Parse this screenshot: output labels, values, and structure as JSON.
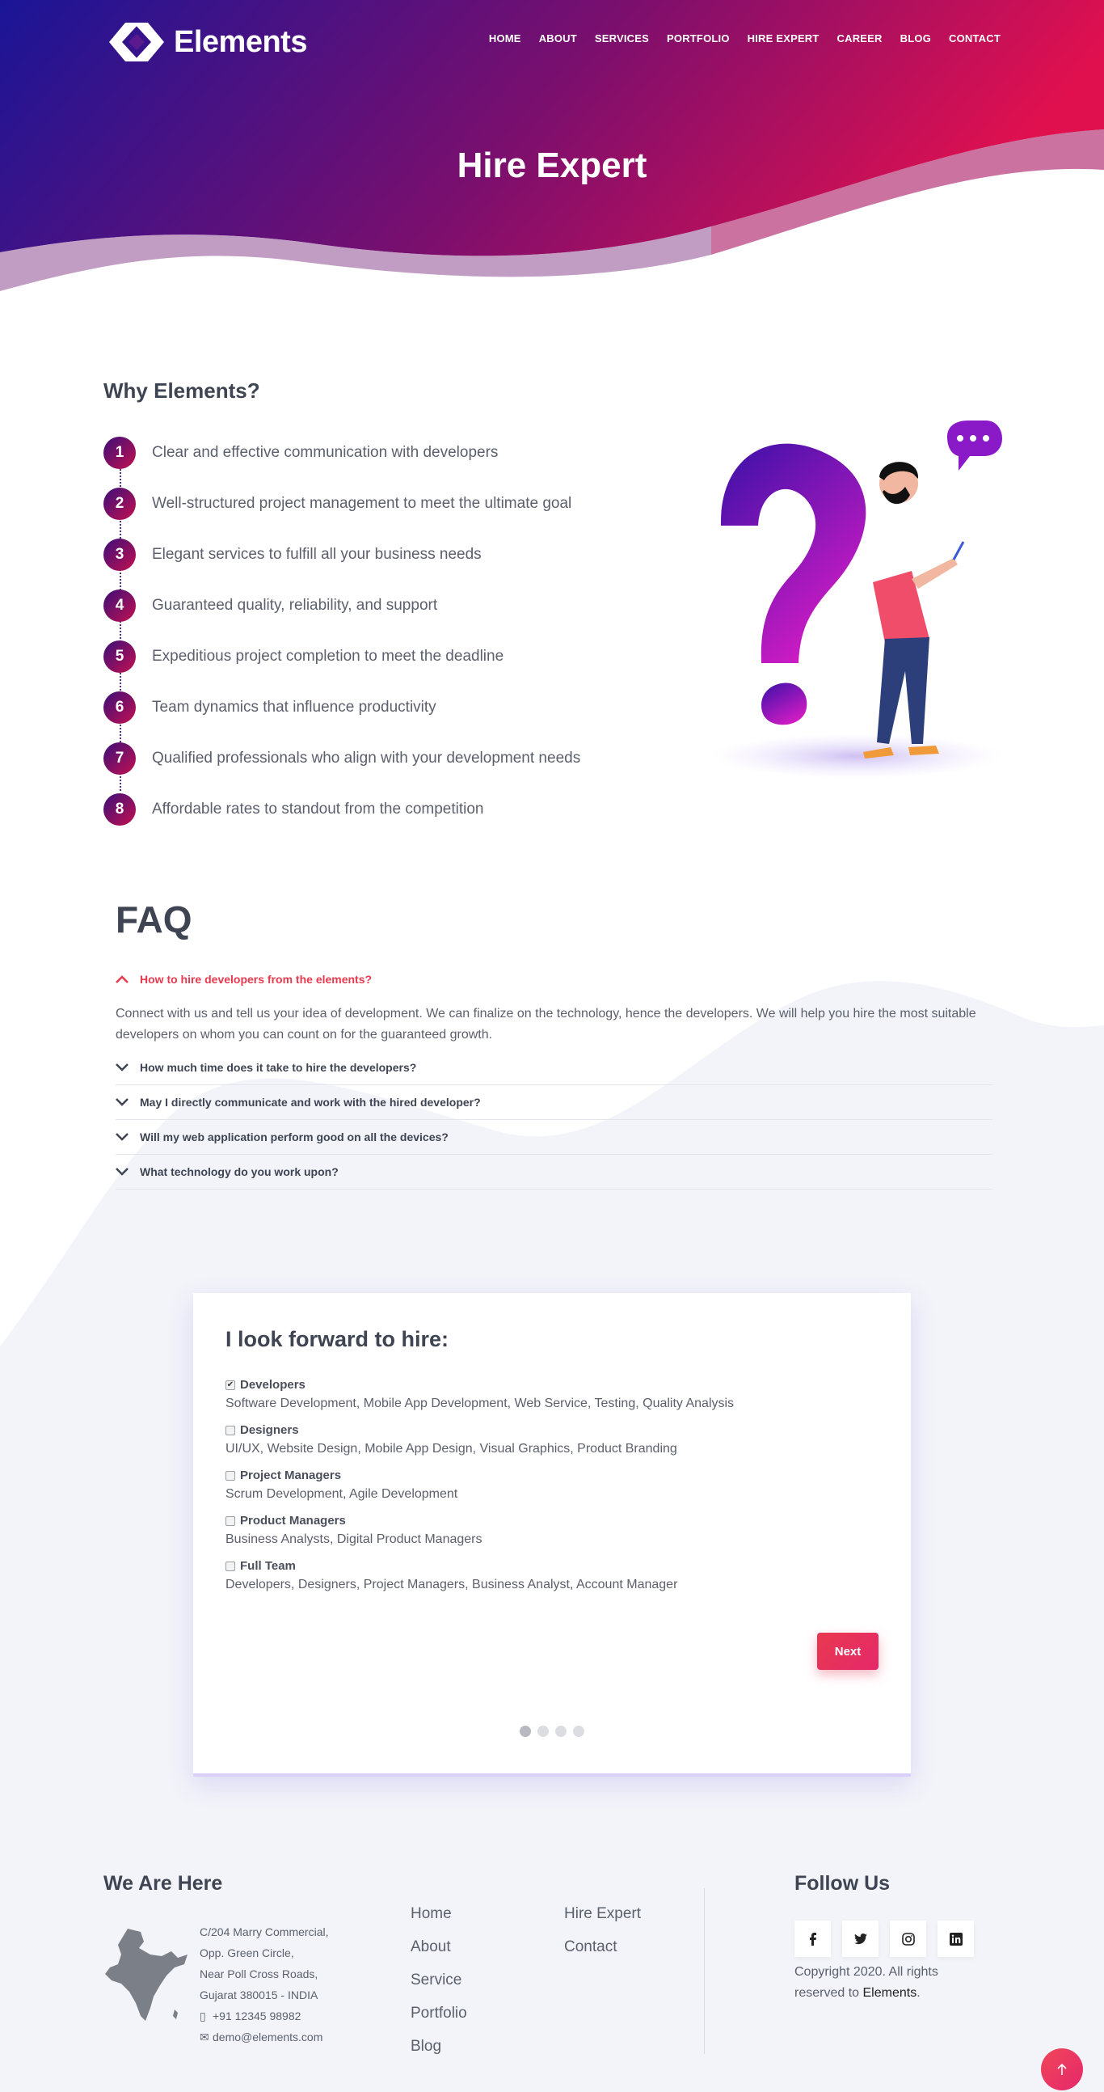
{
  "brand": {
    "name": "Elements"
  },
  "nav": {
    "items": [
      "HOME",
      "ABOUT",
      "SERVICES",
      "PORTFOLIO",
      "HIRE EXPERT",
      "CAREER",
      "BLOG",
      "CONTACT"
    ]
  },
  "hero": {
    "title": "Hire Expert"
  },
  "why": {
    "title": "Why Elements?",
    "items": [
      {
        "num": "1",
        "text": "Clear and effective communication with developers"
      },
      {
        "num": "2",
        "text": "Well-structured project management to meet the ultimate goal"
      },
      {
        "num": "3",
        "text": "Elegant services to fulfill all your business needs"
      },
      {
        "num": "4",
        "text": "Guaranteed quality, reliability, and support"
      },
      {
        "num": "5",
        "text": "Expeditious project completion to meet the deadline"
      },
      {
        "num": "6",
        "text": "Team dynamics that influence productivity"
      },
      {
        "num": "7",
        "text": "Qualified professionals who align with your development needs"
      },
      {
        "num": "8",
        "text": "Affordable rates to standout from the competition"
      }
    ]
  },
  "faq": {
    "title": "FAQ",
    "items": [
      {
        "q": "How to hire developers from the elements?",
        "a": "Connect with us and tell us your idea of development. We can finalize on the technology, hence the developers. We will help you hire the most suitable developers on whom you can count on for the guaranteed growth.",
        "open": true
      },
      {
        "q": "How much time does it take to hire the developers?"
      },
      {
        "q": "May I directly communicate and work with the hired developer?"
      },
      {
        "q": "Will my web application perform good on all the devices?"
      },
      {
        "q": "What technology do you work upon?"
      }
    ]
  },
  "hire": {
    "title": "I look forward to hire:",
    "options": [
      {
        "label": "Developers",
        "desc": "Software Development, Mobile App Development, Web Service, Testing, Quality Analysis",
        "checked": true
      },
      {
        "label": "Designers",
        "desc": "UI/UX, Website Design, Mobile App Design, Visual Graphics, Product Branding",
        "checked": false
      },
      {
        "label": "Project Managers",
        "desc": "Scrum Development, Agile Development",
        "checked": false
      },
      {
        "label": "Product Managers",
        "desc": "Business Analysts, Digital Product Managers",
        "checked": false
      },
      {
        "label": "Full Team",
        "desc": "Developers, Designers, Project Managers, Business Analyst, Account Manager",
        "checked": false
      }
    ],
    "next_label": "Next",
    "steps_total": 4,
    "step_active": 1
  },
  "footer": {
    "here_title": "We Are Here",
    "address": [
      "C/204 Marry Commercial,",
      "Opp. Green Circle,",
      "Near Poll Cross Roads,",
      "Gujarat 380015 - INDIA"
    ],
    "phone": "+91 12345 98982",
    "email": "demo@elements.com",
    "links_col1": [
      "Home",
      "About",
      "Service",
      "Portfolio",
      "Blog"
    ],
    "links_col2": [
      "Hire Expert",
      "Contact"
    ],
    "follow_title": "Follow Us",
    "socials": [
      "facebook-icon",
      "twitter-icon",
      "instagram-icon",
      "linkedin-icon"
    ],
    "copyright_prefix": "Copyright 2020. All rights reserved to",
    "copyright_brand": "Elements",
    "copyright_suffix": "."
  },
  "colors": {
    "accent": "#e8394f",
    "hero_start": "#1a1596",
    "hero_end": "#e0104f",
    "bg_soft": "#f2f4f9"
  }
}
